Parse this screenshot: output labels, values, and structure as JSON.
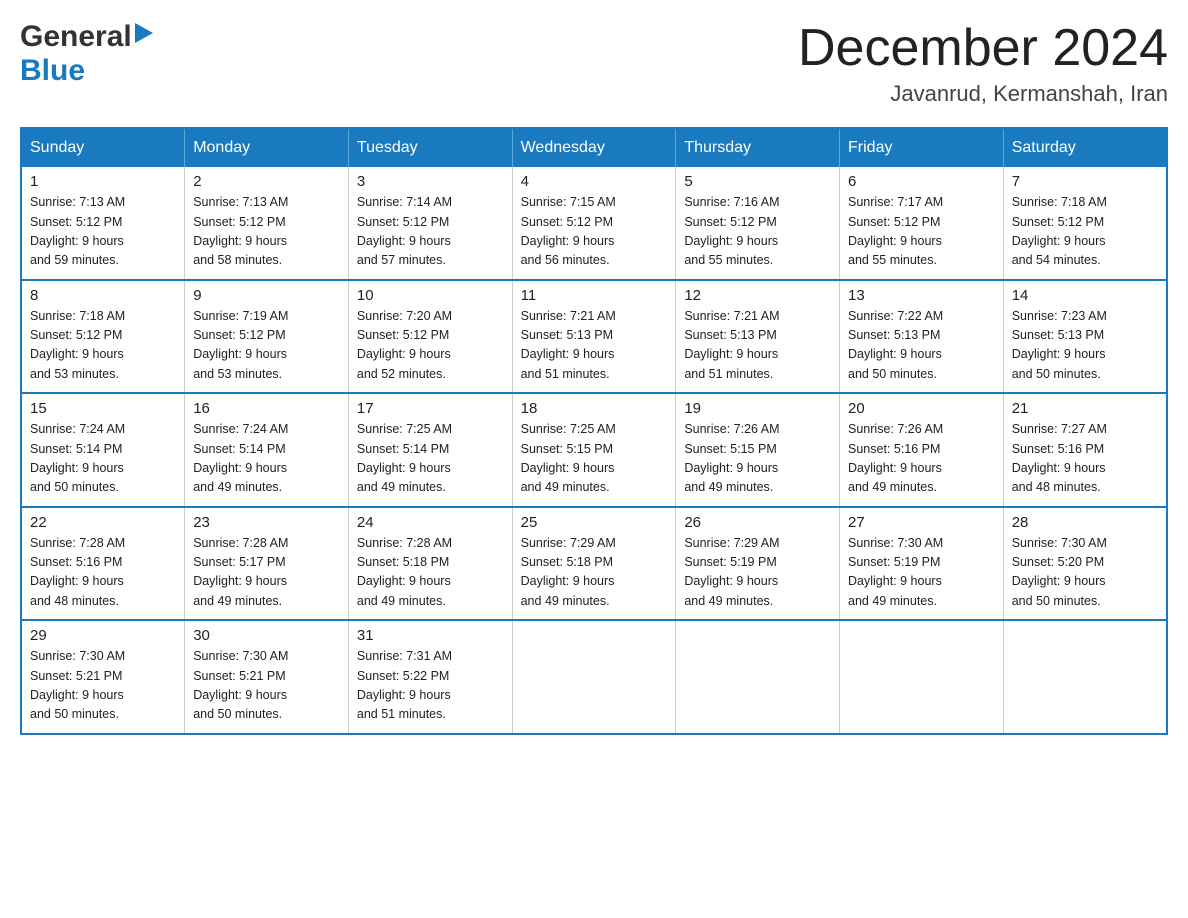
{
  "logo": {
    "general": "General",
    "blue": "Blue"
  },
  "title": {
    "month": "December 2024",
    "location": "Javanrud, Kermanshah, Iran"
  },
  "days_of_week": [
    "Sunday",
    "Monday",
    "Tuesday",
    "Wednesday",
    "Thursday",
    "Friday",
    "Saturday"
  ],
  "weeks": [
    [
      {
        "day": "1",
        "sunrise": "7:13 AM",
        "sunset": "5:12 PM",
        "daylight": "9 hours and 59 minutes."
      },
      {
        "day": "2",
        "sunrise": "7:13 AM",
        "sunset": "5:12 PM",
        "daylight": "9 hours and 58 minutes."
      },
      {
        "day": "3",
        "sunrise": "7:14 AM",
        "sunset": "5:12 PM",
        "daylight": "9 hours and 57 minutes."
      },
      {
        "day": "4",
        "sunrise": "7:15 AM",
        "sunset": "5:12 PM",
        "daylight": "9 hours and 56 minutes."
      },
      {
        "day": "5",
        "sunrise": "7:16 AM",
        "sunset": "5:12 PM",
        "daylight": "9 hours and 55 minutes."
      },
      {
        "day": "6",
        "sunrise": "7:17 AM",
        "sunset": "5:12 PM",
        "daylight": "9 hours and 55 minutes."
      },
      {
        "day": "7",
        "sunrise": "7:18 AM",
        "sunset": "5:12 PM",
        "daylight": "9 hours and 54 minutes."
      }
    ],
    [
      {
        "day": "8",
        "sunrise": "7:18 AM",
        "sunset": "5:12 PM",
        "daylight": "9 hours and 53 minutes."
      },
      {
        "day": "9",
        "sunrise": "7:19 AM",
        "sunset": "5:12 PM",
        "daylight": "9 hours and 53 minutes."
      },
      {
        "day": "10",
        "sunrise": "7:20 AM",
        "sunset": "5:12 PM",
        "daylight": "9 hours and 52 minutes."
      },
      {
        "day": "11",
        "sunrise": "7:21 AM",
        "sunset": "5:13 PM",
        "daylight": "9 hours and 51 minutes."
      },
      {
        "day": "12",
        "sunrise": "7:21 AM",
        "sunset": "5:13 PM",
        "daylight": "9 hours and 51 minutes."
      },
      {
        "day": "13",
        "sunrise": "7:22 AM",
        "sunset": "5:13 PM",
        "daylight": "9 hours and 50 minutes."
      },
      {
        "day": "14",
        "sunrise": "7:23 AM",
        "sunset": "5:13 PM",
        "daylight": "9 hours and 50 minutes."
      }
    ],
    [
      {
        "day": "15",
        "sunrise": "7:24 AM",
        "sunset": "5:14 PM",
        "daylight": "9 hours and 50 minutes."
      },
      {
        "day": "16",
        "sunrise": "7:24 AM",
        "sunset": "5:14 PM",
        "daylight": "9 hours and 49 minutes."
      },
      {
        "day": "17",
        "sunrise": "7:25 AM",
        "sunset": "5:14 PM",
        "daylight": "9 hours and 49 minutes."
      },
      {
        "day": "18",
        "sunrise": "7:25 AM",
        "sunset": "5:15 PM",
        "daylight": "9 hours and 49 minutes."
      },
      {
        "day": "19",
        "sunrise": "7:26 AM",
        "sunset": "5:15 PM",
        "daylight": "9 hours and 49 minutes."
      },
      {
        "day": "20",
        "sunrise": "7:26 AM",
        "sunset": "5:16 PM",
        "daylight": "9 hours and 49 minutes."
      },
      {
        "day": "21",
        "sunrise": "7:27 AM",
        "sunset": "5:16 PM",
        "daylight": "9 hours and 48 minutes."
      }
    ],
    [
      {
        "day": "22",
        "sunrise": "7:28 AM",
        "sunset": "5:16 PM",
        "daylight": "9 hours and 48 minutes."
      },
      {
        "day": "23",
        "sunrise": "7:28 AM",
        "sunset": "5:17 PM",
        "daylight": "9 hours and 49 minutes."
      },
      {
        "day": "24",
        "sunrise": "7:28 AM",
        "sunset": "5:18 PM",
        "daylight": "9 hours and 49 minutes."
      },
      {
        "day": "25",
        "sunrise": "7:29 AM",
        "sunset": "5:18 PM",
        "daylight": "9 hours and 49 minutes."
      },
      {
        "day": "26",
        "sunrise": "7:29 AM",
        "sunset": "5:19 PM",
        "daylight": "9 hours and 49 minutes."
      },
      {
        "day": "27",
        "sunrise": "7:30 AM",
        "sunset": "5:19 PM",
        "daylight": "9 hours and 49 minutes."
      },
      {
        "day": "28",
        "sunrise": "7:30 AM",
        "sunset": "5:20 PM",
        "daylight": "9 hours and 50 minutes."
      }
    ],
    [
      {
        "day": "29",
        "sunrise": "7:30 AM",
        "sunset": "5:21 PM",
        "daylight": "9 hours and 50 minutes."
      },
      {
        "day": "30",
        "sunrise": "7:30 AM",
        "sunset": "5:21 PM",
        "daylight": "9 hours and 50 minutes."
      },
      {
        "day": "31",
        "sunrise": "7:31 AM",
        "sunset": "5:22 PM",
        "daylight": "9 hours and 51 minutes."
      },
      null,
      null,
      null,
      null
    ]
  ],
  "labels": {
    "sunrise": "Sunrise:",
    "sunset": "Sunset:",
    "daylight": "Daylight:"
  }
}
